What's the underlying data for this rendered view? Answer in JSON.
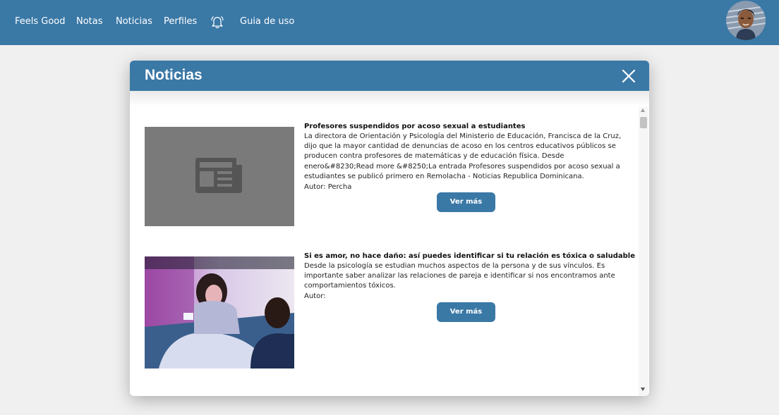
{
  "nav": {
    "brand": "Feels Good",
    "items": [
      "Notas",
      "Noticias",
      "Perfiles"
    ],
    "guide": "Guia de uso",
    "notification_icon": "bell-icon",
    "avatar": "user-avatar"
  },
  "modal": {
    "title": "Noticias",
    "close_icon": "close-icon",
    "articles": [
      {
        "title": "Profesores suspendidos por acoso sexual a estudiantes",
        "body": "La directora de Orientación y Psicología del Ministerio de Educación, Francisca de la Cruz, dijo que la mayor cantidad de denuncias de acoso en los centros educativos públicos se producen contra profesores de matemáticas y de educación física. Desde enero&#8230;Read more &#8250;La entrada Profesores suspendidos por acoso sexual a estudiantes se publicó primero en Remolacha - Noticias Republica Dominicana.",
        "author": "Autor: Percha",
        "button": "Ver más",
        "image_icon": "newspaper-icon"
      },
      {
        "title": "Si es amor, no hace daño: así puedes identificar si tu relación es tóxica o saludable",
        "body": "Desde la psicología se estudian muchos aspectos de la persona y de sus vínculos.  Es importante saber analizar las relaciones de pareja e identificar si nos encontramos ante comportamientos tóxicos.",
        "author": "Autor:",
        "button": "Ver más",
        "image": "couple-in-bed-photo"
      }
    ]
  },
  "colors": {
    "primary": "#3a78a6",
    "background": "#f0f0f0",
    "placeholder": "#7a7a7a"
  }
}
